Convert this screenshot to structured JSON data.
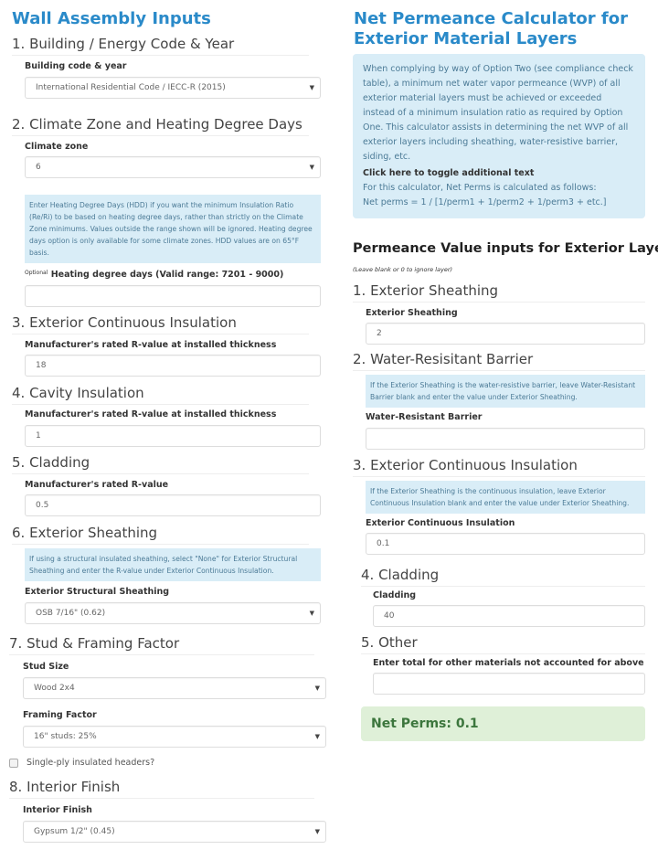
{
  "left": {
    "title": "Wall Assembly Inputs",
    "sections": {
      "s1": {
        "heading": "1. Building / Energy Code & Year",
        "label": "Building code & year",
        "value": "International Residential Code / IECC-R (2015)"
      },
      "s2": {
        "heading": "2. Climate Zone and Heating Degree Days",
        "label": "Climate zone",
        "value": "6",
        "note": "Enter Heating Degree Days (HDD) if you want the minimum Insulation Ratio (Re/Ri) to be based on heating degree days, rather than strictly on the Climate Zone minimums. Values outside the range shown will be ignored. Heating degree days option is only available for some climate zones. HDD values are on 65°F basis.",
        "hdd_optional": "Optional",
        "hdd_label": "Heating degree days (Valid range: 7201 - 9000)",
        "hdd_value": ""
      },
      "s3": {
        "heading": "3. Exterior Continuous Insulation",
        "label": "Manufacturer's rated R-value at installed thickness",
        "value": "18"
      },
      "s4": {
        "heading": "4. Cavity Insulation",
        "label": "Manufacturer's rated R-value at installed thickness",
        "value": "1"
      },
      "s5": {
        "heading": "5. Cladding",
        "label": "Manufacturer's rated R-value",
        "value": "0.5"
      },
      "s6": {
        "heading": "6. Exterior Sheathing",
        "note": "If using a structural insulated sheathing, select \"None\" for Exterior Structural Sheathing and enter the R-value under Exterior Continuous Insulation.",
        "label": "Exterior Structural Sheathing",
        "value": "OSB 7/16\" (0.62)"
      },
      "s7": {
        "heading": "7. Stud & Framing Factor",
        "stud_label": "Stud Size",
        "stud_value": "Wood 2x4",
        "ff_label": "Framing Factor",
        "ff_value": "16\" studs: 25%",
        "checkbox_label": "Single-ply insulated headers?",
        "checkbox_checked": false
      },
      "s8": {
        "heading": "8. Interior Finish",
        "label": "Interior Finish",
        "value": "Gypsum 1/2\" (0.45)"
      }
    }
  },
  "right": {
    "title": "Net Permeance Calculator for Exterior Material Layers",
    "intro": "When complying by way of Option Two (see compliance check table), a minimum net water vapor permeance (WVP) of all exterior material layers must be achieved or exceeded instead of a minimum insulation ratio as required by Option One. This calculator assists in determining the net WVP of all exterior layers including sheathing, water-resistive barrier, siding, etc.",
    "toggle_link": "Click here to toggle additional text",
    "formula_intro": "For this calculator, Net Perms is calculated as follows:",
    "formula": "Net perms = 1 / [1/perm1 + 1/perm2 + 1/perm3 + etc.]",
    "subtitle": "Permeance Value inputs for Exterior Layers",
    "subnote": "(Leave blank or 0 to ignore layer)",
    "sections": {
      "p1": {
        "heading": "1. Exterior Sheathing",
        "label": "Exterior Sheathing",
        "value": "2"
      },
      "p2": {
        "heading": "2. Water-Resisitant Barrier",
        "note": "If the Exterior Sheathing is the water-resistive barrier, leave Water-Resistant Barrier blank and enter the value under Exterior Sheathing.",
        "label": "Water-Resistant Barrier",
        "value": ""
      },
      "p3": {
        "heading": "3. Exterior Continuous Insulation",
        "note": "If the Exterior Sheathing is the continuous insulation, leave Exterior Continuous Insulation blank and enter the value under Exterior Sheathing.",
        "label": "Exterior Continuous Insulation",
        "value": "0.1"
      },
      "p4": {
        "heading": "4. Cladding",
        "label": "Cladding",
        "value": "40"
      },
      "p5": {
        "heading": "5. Other",
        "label": "Enter total for other materials not accounted for above",
        "value": ""
      }
    },
    "result": "Net Perms: 0.1"
  },
  "colors": {
    "accent": "#2a8ac9",
    "info_bg": "#d9edf7",
    "success_bg": "#dff0d8",
    "success_text": "#3c763d"
  }
}
